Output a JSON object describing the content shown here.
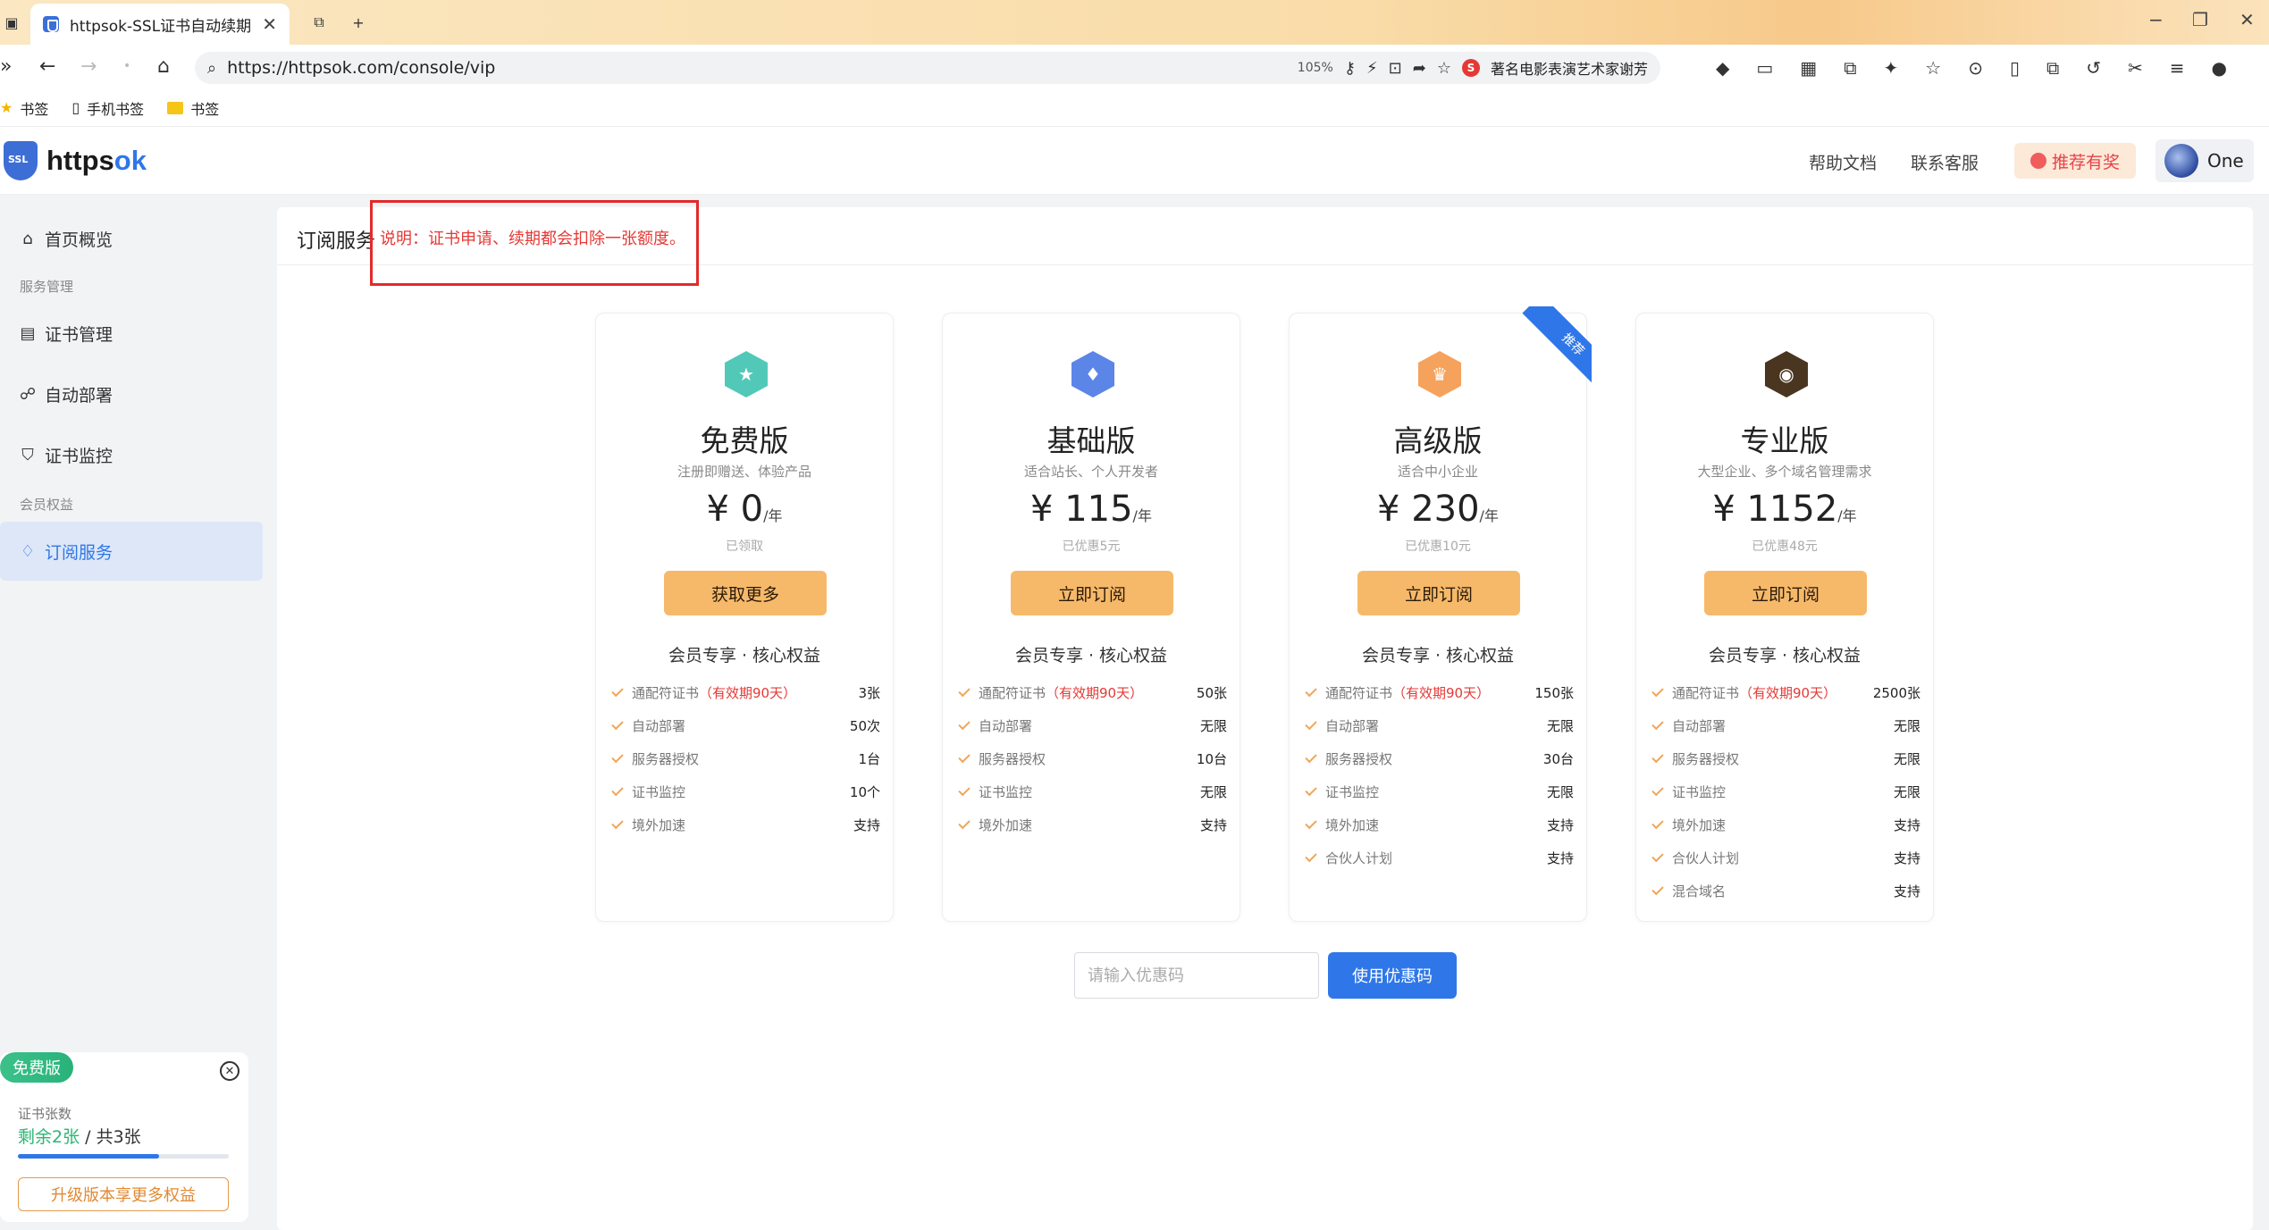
{
  "browser": {
    "tab_title": "httpsok-SSL证书自动续期",
    "url": "https://httpsok.com/console/vip",
    "zoom": "105%",
    "news_text": "著名电影表演艺术家谢芳",
    "bookmarks": [
      "书签",
      "手机书签",
      "书签"
    ]
  },
  "header": {
    "logo_prefix": "https",
    "logo_suffix": "ok",
    "logo_badge": "SSL",
    "help_link": "帮助文档",
    "contact_link": "联系客服",
    "reward_button": "推荐有奖",
    "user_name": "One"
  },
  "sidebar": {
    "home": "首页概览",
    "group_service": "服务管理",
    "cert_manage": "证书管理",
    "auto_deploy": "自动部署",
    "cert_monitor": "证书监控",
    "group_member": "会员权益",
    "subscription": "订阅服务"
  },
  "free_card": {
    "badge": "免费版",
    "label": "证书张数",
    "remaining": "剩余2张",
    "total": " / 共3张",
    "progress": 0.67,
    "upgrade_button": "升级版本享更多权益"
  },
  "main": {
    "title": "订阅服务",
    "notice": "说明：证书申请、续期都会扣除一张额度。",
    "coupon_placeholder": "请输入优惠码",
    "coupon_button": "使用优惠码"
  },
  "plans": [
    {
      "name": "免费版",
      "desc": "注册即赠送、体验产品",
      "price": "¥ 0",
      "unit": "/年",
      "note": "已领取",
      "button": "获取更多",
      "benefit_title": "会员专享 · 核心权益",
      "icon_color": "#52c9b8",
      "icon": "star-icon",
      "benefits": [
        {
          "label": "通配符证书",
          "extra": "（有效期90天）",
          "value": "3张"
        },
        {
          "label": "自动部署",
          "extra": "",
          "value": "50次"
        },
        {
          "label": "服务器授权",
          "extra": "",
          "value": "1台"
        },
        {
          "label": "证书监控",
          "extra": "",
          "value": "10个"
        },
        {
          "label": "境外加速",
          "extra": "",
          "value": "支持"
        }
      ]
    },
    {
      "name": "基础版",
      "desc": "适合站长、个人开发者",
      "price": "¥ 115",
      "unit": "/年",
      "note": "已优惠5元",
      "button": "立即订阅",
      "benefit_title": "会员专享 · 核心权益",
      "icon_color": "#5b86e8",
      "icon": "diamond-icon",
      "benefits": [
        {
          "label": "通配符证书",
          "extra": "（有效期90天）",
          "value": "50张"
        },
        {
          "label": "自动部署",
          "extra": "",
          "value": "无限"
        },
        {
          "label": "服务器授权",
          "extra": "",
          "value": "10台"
        },
        {
          "label": "证书监控",
          "extra": "",
          "value": "无限"
        },
        {
          "label": "境外加速",
          "extra": "",
          "value": "支持"
        }
      ]
    },
    {
      "name": "高级版",
      "desc": "适合中小企业",
      "price": "¥ 230",
      "unit": "/年",
      "note": "已优惠10元",
      "button": "立即订阅",
      "benefit_title": "会员专享 · 核心权益",
      "icon_color": "#f5a25d",
      "icon": "crown-icon",
      "ribbon": "推荐",
      "benefits": [
        {
          "label": "通配符证书",
          "extra": "（有效期90天）",
          "value": "150张"
        },
        {
          "label": "自动部署",
          "extra": "",
          "value": "无限"
        },
        {
          "label": "服务器授权",
          "extra": "",
          "value": "30台"
        },
        {
          "label": "证书监控",
          "extra": "",
          "value": "无限"
        },
        {
          "label": "境外加速",
          "extra": "",
          "value": "支持"
        },
        {
          "label": "合伙人计划",
          "extra": "",
          "value": "支持"
        }
      ]
    },
    {
      "name": "专业版",
      "desc": "大型企业、多个域名管理需求",
      "price": "¥ 1152",
      "unit": "/年",
      "note": "已优惠48元",
      "button": "立即订阅",
      "benefit_title": "会员专享 · 核心权益",
      "icon_color": "#4a3520",
      "icon": "lion-icon",
      "benefits": [
        {
          "label": "通配符证书",
          "extra": "（有效期90天）",
          "value": "2500张"
        },
        {
          "label": "自动部署",
          "extra": "",
          "value": "无限"
        },
        {
          "label": "服务器授权",
          "extra": "",
          "value": "无限"
        },
        {
          "label": "证书监控",
          "extra": "",
          "value": "无限"
        },
        {
          "label": "境外加速",
          "extra": "",
          "value": "支持"
        },
        {
          "label": "合伙人计划",
          "extra": "",
          "value": "支持"
        },
        {
          "label": "混合域名",
          "extra": "",
          "value": "支持"
        }
      ]
    }
  ]
}
